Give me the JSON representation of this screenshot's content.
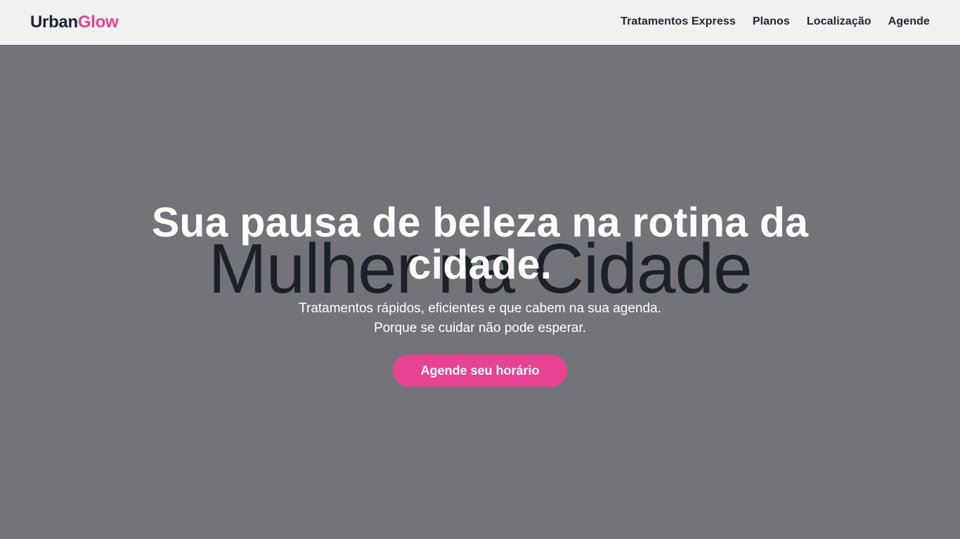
{
  "brand": {
    "logo_primary": "Urban",
    "logo_accent": "Glow",
    "accent_color": "#e84393",
    "dark_color": "#1d2433"
  },
  "nav": {
    "items": [
      {
        "label": "Tratamentos Express"
      },
      {
        "label": "Planos"
      },
      {
        "label": "Localização"
      },
      {
        "label": "Agende"
      }
    ]
  },
  "hero": {
    "background_color": "#72747a",
    "watermark": "Mulher na Cidade",
    "title": "Sua pausa de beleza na rotina da cidade.",
    "subtitle_line1": "Tratamentos rápidos, eficientes e que cabem na sua agenda.",
    "subtitle_line2": "Porque se cuidar não pode esperar.",
    "cta_label": "Agende seu horário"
  }
}
